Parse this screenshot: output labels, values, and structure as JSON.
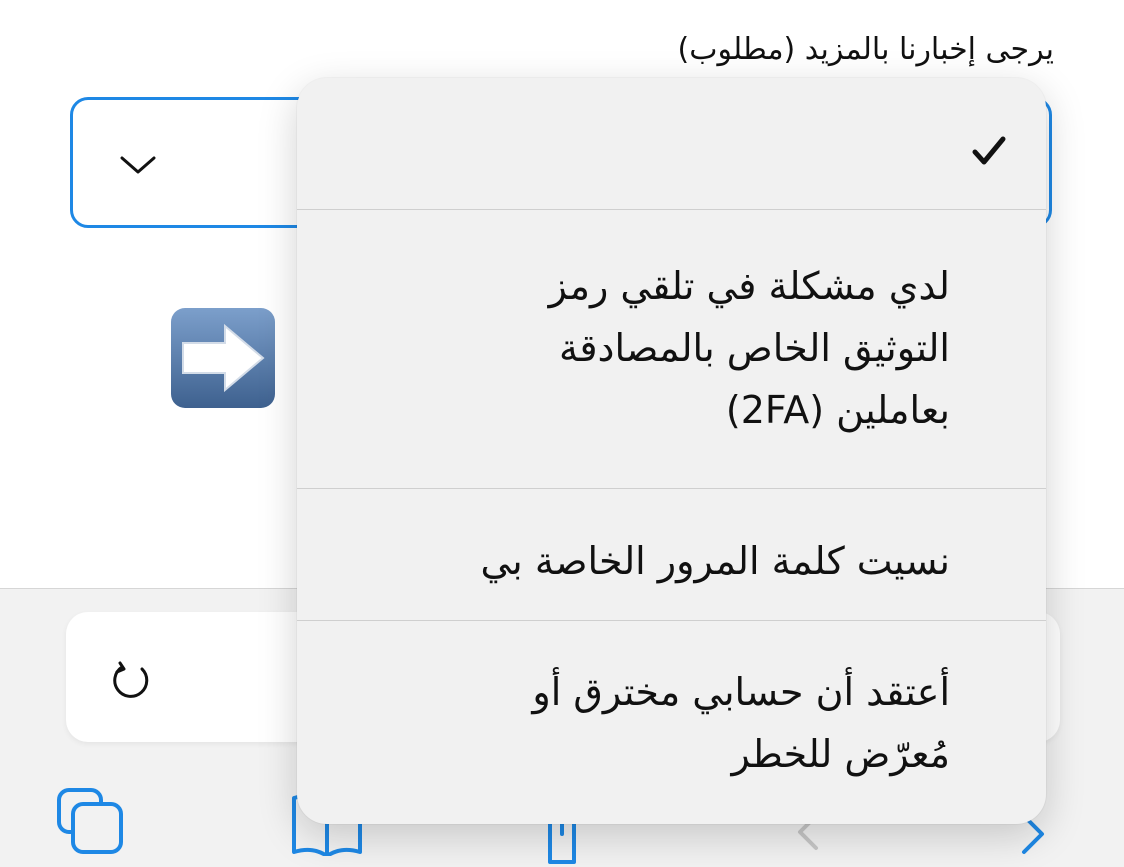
{
  "form": {
    "question_label": "يرجى إخبارنا بالمزيد (مطلوب)",
    "select_chevron_icon": "chevron-down-icon"
  },
  "emoji": {
    "name": "right-arrow-emoji-icon"
  },
  "browser": {
    "reload_icon": "reload-icon",
    "toolbar_icons": [
      "tabs-icon",
      "bookmarks-icon",
      "share-icon",
      "back-icon",
      "forward-icon"
    ],
    "accent": "#1e88e5"
  },
  "menu": {
    "options": [
      {
        "label": "",
        "selected": true
      },
      {
        "label": "لدي مشكلة في تلقي رمز\nالتوثيق الخاص بالمصادقة\nبعاملين (2FA)",
        "selected": false
      },
      {
        "label": "نسيت كلمة المرور الخاصة بي",
        "selected": false
      },
      {
        "label": "أعتقد أن حسابي مخترق أو\nمُعرّض للخطر",
        "selected": false
      }
    ],
    "checkmark_icon": "checkmark-icon"
  }
}
